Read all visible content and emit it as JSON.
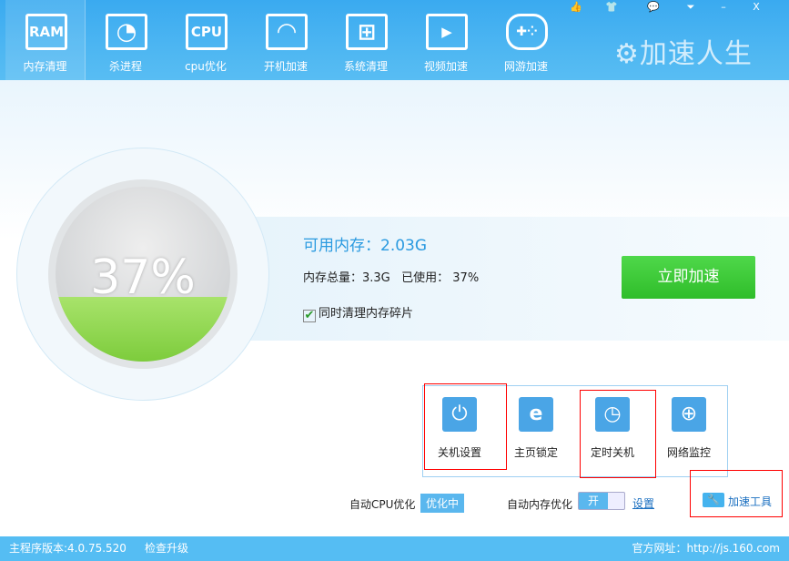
{
  "nav": [
    {
      "icon": "RAM",
      "label": "内存清理"
    },
    {
      "icon": "◔",
      "label": "杀进程"
    },
    {
      "icon": "CPU",
      "label": "cpu优化"
    },
    {
      "icon": "◠",
      "label": "开机加速"
    },
    {
      "icon": "⊞",
      "label": "系统清理"
    },
    {
      "icon": "▶",
      "label": "视频加速"
    },
    {
      "icon": "✚⁘",
      "label": "网游加速"
    }
  ],
  "window_buttons": [
    "👍",
    "👕",
    "💬",
    "⏷",
    "–",
    "X"
  ],
  "brand": "⚙加速人生",
  "memory": {
    "percent": "37%",
    "percent_value": 37,
    "available": "可用内存：2.03G",
    "total": "内存总量：3.3G   已使用： 37%",
    "defrag_label": "同时清理内存碎片",
    "defrag_checked": true
  },
  "accelerate_button": "立即加速",
  "tools": [
    {
      "icon": "⏻",
      "label": "关机设置"
    },
    {
      "icon": "e",
      "label": "主页锁定"
    },
    {
      "icon": "◷",
      "label": "定时关机"
    },
    {
      "icon": "⊕",
      "label": "网络监控"
    }
  ],
  "options": {
    "cpu_label": "自动CPU优化",
    "cpu_status": "优化中",
    "mem_label": "自动内存优化",
    "mem_toggle": "开",
    "settings": "设置",
    "tools_link": "加速工具"
  },
  "footer": {
    "version": "主程序版本:4.0.75.520",
    "upgrade": "检查升级",
    "site": "官方网址：http://js.160.com"
  },
  "colors": {
    "header": "#4db6f2",
    "accent_green": "#3cc935",
    "fill_green": "#8fd651"
  }
}
